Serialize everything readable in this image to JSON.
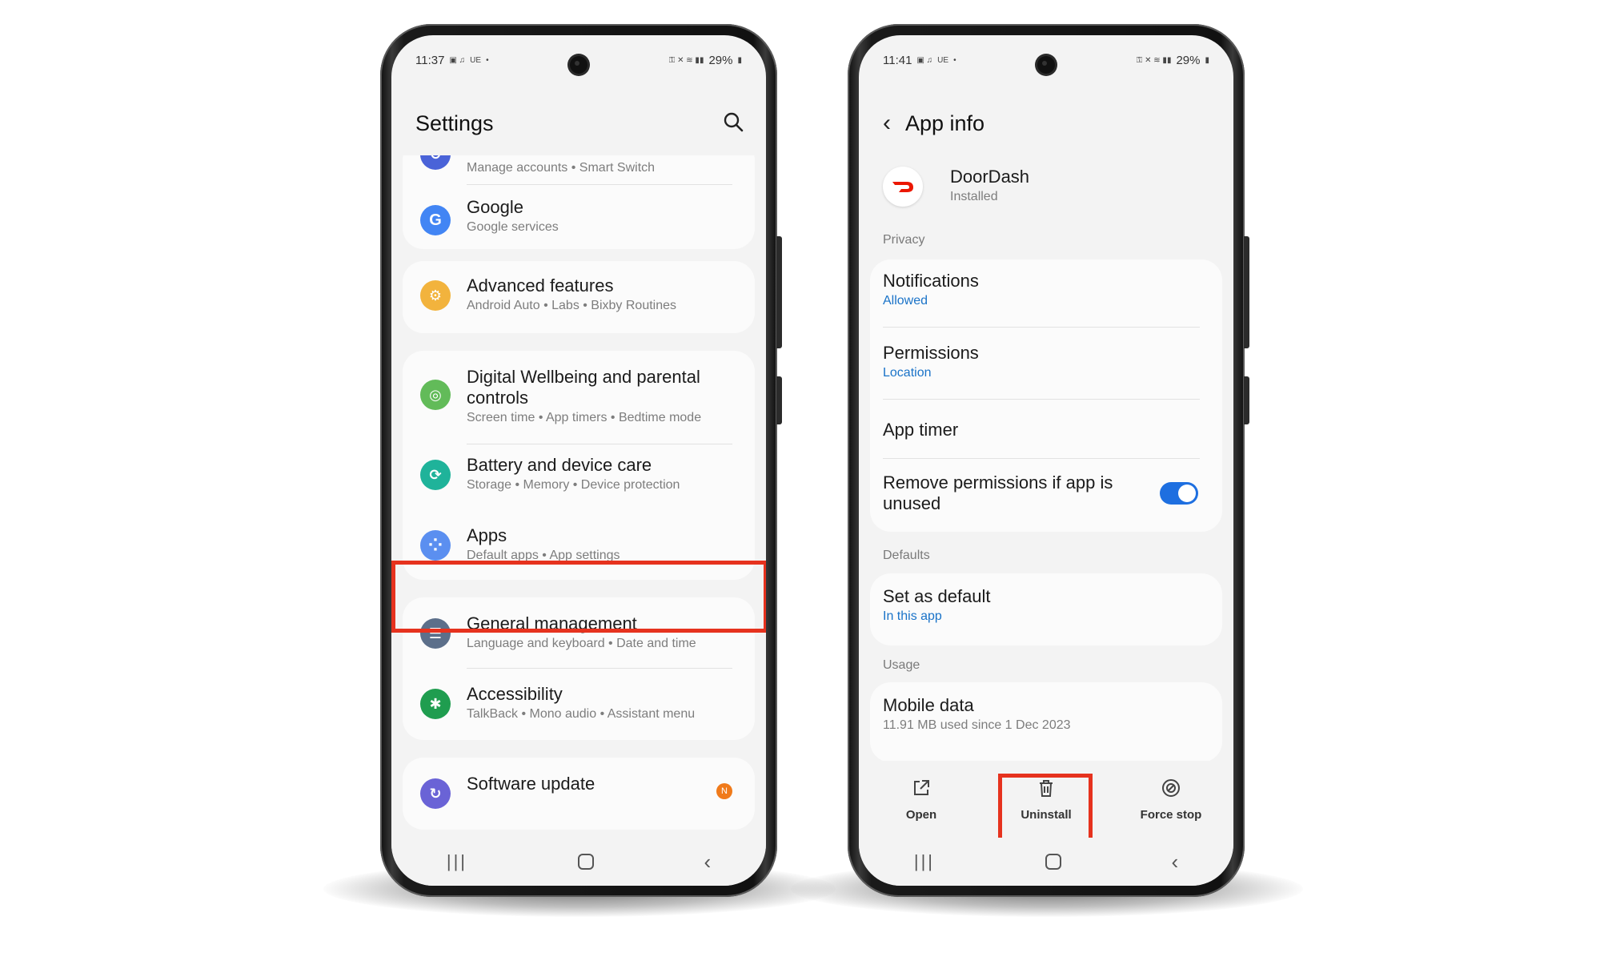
{
  "colors": {
    "highlight": "#e6321e",
    "link_blue": "#1a73c8",
    "toggle_on": "#1e6fe0",
    "doordash_red": "#eb1700"
  },
  "left_phone": {
    "status": {
      "time": "11:37",
      "carrier_icons": "UE",
      "battery": "29%"
    },
    "header": {
      "title": "Settings",
      "search_icon": "search-icon"
    },
    "items": [
      {
        "id": "accounts",
        "icon": "accounts-icon",
        "icon_color": "#4a63d8",
        "title": "",
        "subtitle": "Manage accounts  •  Smart Switch"
      },
      {
        "id": "google",
        "icon": "google-icon",
        "icon_color": "#4285f4",
        "icon_glyph": "G",
        "title": "Google",
        "subtitle": "Google services"
      },
      {
        "id": "advanced",
        "icon": "gear-icon",
        "icon_color": "#f2b33d",
        "icon_glyph": "⚙",
        "title": "Advanced features",
        "subtitle": "Android Auto  •  Labs  •  Bixby Routines"
      },
      {
        "id": "wellbeing",
        "icon": "wellbeing-icon",
        "icon_color": "#62bb59",
        "icon_glyph": "◎",
        "title": "Digital Wellbeing and parental controls",
        "subtitle": "Screen time  •  App timers  •  Bedtime mode"
      },
      {
        "id": "battery",
        "icon": "battery-care-icon",
        "icon_color": "#1fb39a",
        "icon_glyph": "⟳",
        "title": "Battery and device care",
        "subtitle": "Storage  •  Memory  •  Device protection"
      },
      {
        "id": "apps",
        "icon": "apps-icon",
        "icon_color": "#5b8ff0",
        "icon_glyph": "⁘",
        "title": "Apps",
        "subtitle": "Default apps  •  App settings"
      },
      {
        "id": "general",
        "icon": "sliders-icon",
        "icon_color": "#5c6f8a",
        "icon_glyph": "☰",
        "title": "General management",
        "subtitle": "Language and keyboard  •  Date and time"
      },
      {
        "id": "accessibility",
        "icon": "accessibility-icon",
        "icon_color": "#1f9d4f",
        "icon_glyph": "✱",
        "title": "Accessibility",
        "subtitle": "TalkBack  •  Mono audio  •  Assistant menu"
      },
      {
        "id": "software",
        "icon": "software-update-icon",
        "icon_color": "#6a63d6",
        "icon_glyph": "↻",
        "title": "Software update",
        "subtitle": "",
        "badge": "N"
      }
    ]
  },
  "right_phone": {
    "status": {
      "time": "11:41",
      "carrier_icons": "UE",
      "battery": "29%"
    },
    "header": {
      "title": "App info",
      "back_icon": "back-arrow-icon"
    },
    "app": {
      "name": "DoorDash",
      "status": "Installed"
    },
    "sections": {
      "privacy": "Privacy",
      "defaults": "Defaults",
      "usage": "Usage"
    },
    "privacy_items": [
      {
        "title": "Notifications",
        "subtitle": "Allowed"
      },
      {
        "title": "Permissions",
        "subtitle": "Location"
      },
      {
        "title": "App timer",
        "subtitle": ""
      },
      {
        "title": "Remove permissions if app is unused",
        "toggle": true
      }
    ],
    "defaults_item": {
      "title": "Set as default",
      "subtitle": "In this app"
    },
    "usage_item": {
      "title": "Mobile data",
      "subtitle": "11.91 MB used since 1 Dec 2023"
    },
    "actions": [
      {
        "label": "Open",
        "icon": "open-external-icon"
      },
      {
        "label": "Uninstall",
        "icon": "trash-icon"
      },
      {
        "label": "Force stop",
        "icon": "force-stop-icon"
      }
    ]
  }
}
